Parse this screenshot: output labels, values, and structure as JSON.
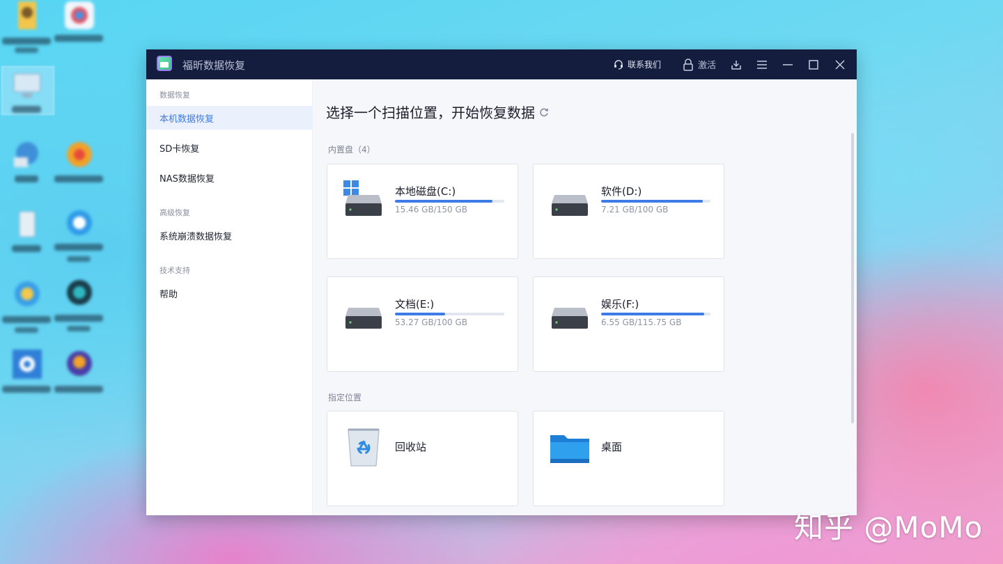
{
  "app": {
    "title": "福昕数据恢复",
    "contact_label": "联系我们",
    "activate_label": "激活"
  },
  "sidebar": {
    "sections": [
      {
        "label": "数据恢复",
        "items": [
          "本机数据恢复",
          "SD卡恢复",
          "NAS数据恢复"
        ]
      },
      {
        "label": "高级恢复",
        "items": [
          "系统崩溃数据恢复"
        ]
      },
      {
        "label": "技术支持",
        "items": [
          "帮助"
        ]
      }
    ],
    "active_item": "本机数据恢复"
  },
  "main": {
    "title": "选择一个扫描位置，开始恢复数据",
    "internal_label": "内置盘（4）",
    "drives": [
      {
        "name": "本地磁盘(C:)",
        "size": "15.46 GB/150 GB",
        "used_fraction": 0.89,
        "system": true
      },
      {
        "name": "软件(D:)",
        "size": "7.21 GB/100 GB",
        "used_fraction": 0.93,
        "system": false
      },
      {
        "name": "文档(E:)",
        "size": "53.27 GB/100 GB",
        "used_fraction": 0.46,
        "system": false
      },
      {
        "name": "娱乐(F:)",
        "size": "6.55 GB/115.75 GB",
        "used_fraction": 0.94,
        "system": false
      }
    ],
    "location_label": "指定位置",
    "locations": [
      {
        "name": "回收站",
        "icon": "recycle-bin-icon"
      },
      {
        "name": "桌面",
        "icon": "folder-icon"
      }
    ]
  },
  "watermark": "知乎 @MoMo",
  "colors": {
    "titlebar": "#141d3e",
    "accent": "#3d7be6",
    "active_bg": "#eaf1fd"
  }
}
